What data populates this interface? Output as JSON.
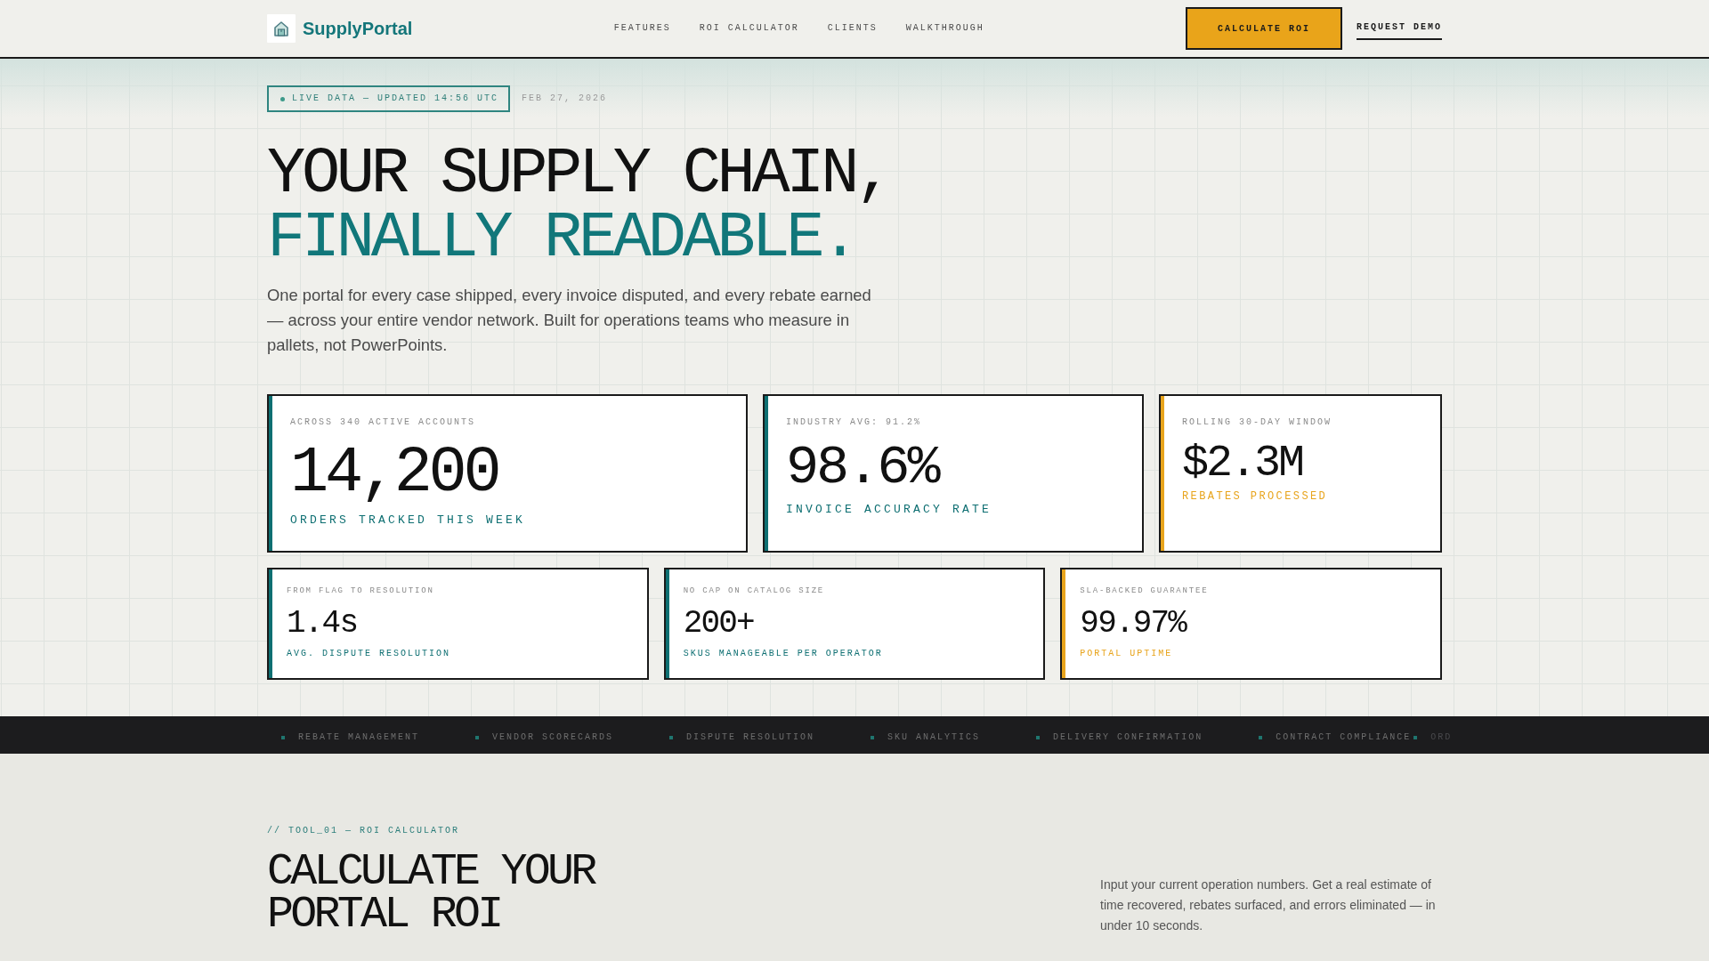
{
  "nav": {
    "brand": "SupplyPortal",
    "links": [
      "FEATURES",
      "ROI CALCULATOR",
      "CLIENTS",
      "WALKTHROUGH"
    ],
    "primary_button": "CALCULATE ROI",
    "secondary_link": "REQUEST DEMO"
  },
  "hero": {
    "status": "LIVE DATA — UPDATED 14:56 UTC",
    "date": "FEB 27, 2026",
    "headline": "YOUR SUPPLY CHAIN,",
    "headline_highlight": "FINALLY READABLE.",
    "description": "One portal for every case shipped, every invoice disputed, and every rebate earned — across your entire vendor network. Built for operations teams who measure in pallets, not PowerPoints."
  },
  "stats": [
    {
      "kind": "large",
      "caption": "ACROSS 340 ACTIVE ACCOUNTS",
      "value": "14,200",
      "label": "ORDERS TRACKED THIS WEEK",
      "color": "#0e6f72"
    },
    {
      "kind": "medium",
      "caption": "INDUSTRY AVG: 91.2%",
      "value": "98.6%",
      "label": "INVOICE ACCURACY RATE",
      "color": "#0e6f72"
    },
    {
      "kind": "small",
      "caption": "ROLLING 30-DAY WINDOW",
      "value": "$2.3M",
      "label": "REBATES PROCESSED",
      "color": "#e8a41c"
    }
  ],
  "metrics": [
    {
      "caption": "FROM FLAG TO RESOLUTION",
      "value": "1.4s",
      "label": "AVG. DISPUTE RESOLUTION",
      "color": "#0e6f72"
    },
    {
      "caption": "NO CAP ON CATALOG SIZE",
      "value": "200+",
      "label": "SKUS MANAGEABLE PER OPERATOR",
      "color": "#0e6f72"
    },
    {
      "caption": "SLA-BACKED GUARANTEE",
      "value": "99.97%",
      "label": "PORTAL UPTIME",
      "color": "#e8a41c"
    }
  ],
  "ticker": [
    {
      "label": "REBATE MANAGEMENT",
      "faded": false
    },
    {
      "label": "VENDOR SCORECARDS",
      "faded": false
    },
    {
      "label": "DISPUTE RESOLUTION",
      "faded": false
    },
    {
      "label": "SKU ANALYTICS",
      "faded": false
    },
    {
      "label": "DELIVERY CONFIRMATION",
      "faded": false
    },
    {
      "label": "CONTRACT COMPLIANCE",
      "faded": false
    },
    {
      "label": "ORD",
      "faded": true
    }
  ],
  "roi_section": {
    "eyebrow": "// TOOL_01 — ROI CALCULATOR",
    "title": "CALCULATE YOUR PORTAL ROI",
    "description": "Input your current operation numbers. Get a real estimate of time recovered, rebates surfaced, and errors eliminated — in under 10 seconds."
  }
}
